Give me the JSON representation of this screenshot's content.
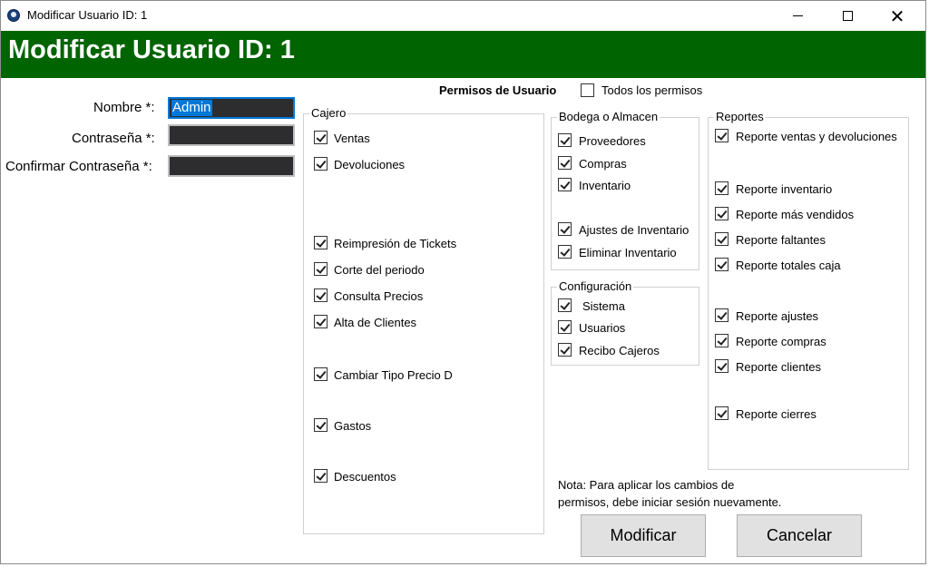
{
  "window": {
    "title": "Modificar Usuario ID: 1",
    "controls": {
      "minimize": "minimize-icon",
      "maximize": "maximize-icon",
      "close": "close-icon"
    }
  },
  "header": {
    "title": "Modificar Usuario ID: 1",
    "background": "#006400",
    "color": "#ffffff"
  },
  "form": {
    "nombre_label": "Nombre *:",
    "nombre_value": "Admin",
    "contrasena_label": "Contraseña *:",
    "confirmar_label": "Confirmar Contraseña *:"
  },
  "permisos": {
    "title": "Permisos de Usuario",
    "todos_label": "Todos los permisos",
    "todos_checked": false
  },
  "groups": {
    "cajero": {
      "title": "Cajero",
      "items": [
        {
          "label": "Ventas",
          "checked": true
        },
        {
          "label": "Devoluciones",
          "checked": true
        },
        {
          "label": "Reimpresión de Tickets",
          "checked": true
        },
        {
          "label": "Corte del periodo",
          "checked": true
        },
        {
          "label": "Consulta Precios",
          "checked": true
        },
        {
          "label": "Alta de Clientes",
          "checked": true
        },
        {
          "label": "Cambiar Tipo Precio D",
          "checked": true
        },
        {
          "label": "Gastos",
          "checked": true
        },
        {
          "label": "Descuentos",
          "checked": true
        }
      ]
    },
    "bodega": {
      "title": "Bodega o Almacen",
      "items": [
        {
          "label": "Proveedores",
          "checked": true
        },
        {
          "label": "Compras",
          "checked": true
        },
        {
          "label": "Inventario",
          "checked": true
        },
        {
          "label": "Ajustes de Inventario",
          "checked": true
        },
        {
          "label": "Eliminar Inventario",
          "checked": true
        }
      ]
    },
    "configuracion": {
      "title": "Configuración",
      "items": [
        {
          "label": "Sistema",
          "checked": true
        },
        {
          "label": "Usuarios",
          "checked": true
        },
        {
          "label": "Recibo Cajeros",
          "checked": true
        }
      ]
    },
    "reportes": {
      "title": "Reportes",
      "items": [
        {
          "label": "Reporte ventas y devoluciones",
          "checked": true
        },
        {
          "label": "Reporte inventario",
          "checked": true
        },
        {
          "label": "Reporte más vendidos",
          "checked": true
        },
        {
          "label": "Reporte faltantes",
          "checked": true
        },
        {
          "label": "Reporte totales caja",
          "checked": true
        },
        {
          "label": "Reporte ajustes",
          "checked": true
        },
        {
          "label": "Reporte compras",
          "checked": true
        },
        {
          "label": "Reporte clientes",
          "checked": true
        },
        {
          "label": "Reporte cierres",
          "checked": true
        }
      ]
    }
  },
  "note": {
    "line1": "Nota:  Para aplicar los cambios de",
    "line2": "permisos, debe iniciar sesión nuevamente."
  },
  "buttons": {
    "modificar": "Modificar",
    "cancelar": "Cancelar"
  }
}
